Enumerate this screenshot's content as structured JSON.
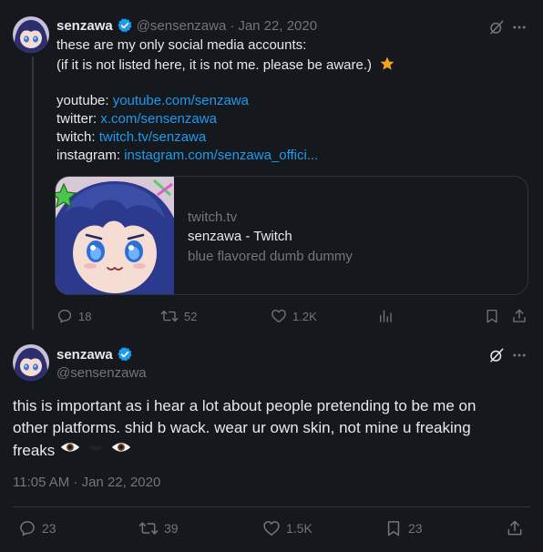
{
  "tweet1": {
    "display_name": "senzawa",
    "handle": "@sensenzawa",
    "date": "Jan 22, 2020",
    "lines": {
      "l1": "these are my only social media accounts:",
      "l2": "(if it is not listed here, it is not me. please be aware.)",
      "yt_label": "youtube:",
      "yt_link": "youtube.com/senzawa",
      "tw_label": "twitter:",
      "tw_link": "x.com/sensenzawa",
      "twitch_label": "twitch:",
      "twitch_link": "twitch.tv/senzawa",
      "ig_label": "instagram:",
      "ig_link": "instagram.com/senzawa_offici..."
    },
    "card": {
      "domain": "twitch.tv",
      "title": "senzawa - Twitch",
      "description": "blue flavored dumb dummy"
    },
    "actions": {
      "replies": "18",
      "retweets": "52",
      "likes": "1.2K"
    }
  },
  "tweet2": {
    "display_name": "senzawa",
    "handle": "@sensenzawa",
    "body": {
      "l1": "this is important as i hear a lot about people pretending to be me on",
      "l2": "other platforms. shid b wack. wear ur own skin, not mine u freaking",
      "l3": "freaks"
    },
    "timestamp": "11:05 AM · Jan 22, 2020",
    "actions": {
      "replies": "23",
      "retweets": "39",
      "likes": "1.5K",
      "bookmarks": "23"
    }
  },
  "icons": [
    "verified-badge-icon",
    "grok-icon",
    "more-icon",
    "reply-icon",
    "retweet-icon",
    "like-icon",
    "views-icon",
    "bookmark-icon",
    "share-icon",
    "star-emoji",
    "eye-emoji"
  ],
  "colors": {
    "background": "#15181c",
    "link": "#1d9bf0",
    "muted": "#71767b",
    "verified": "#1d9bf0"
  }
}
